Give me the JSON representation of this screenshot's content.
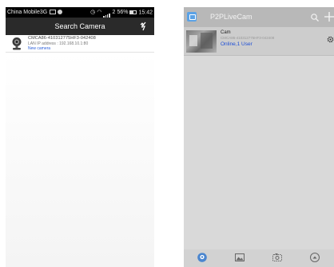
{
  "left_screen": {
    "status_bar": {
      "carrier": "China Mobile3G",
      "battery_percent": "56%",
      "time": "15:42",
      "network_label": "2"
    },
    "title_bar": {
      "title": "Search Camera",
      "refresh_icon": "refresh-icon"
    },
    "camera_item": {
      "name": "CMCA86-410312775HF3-042408",
      "lan_ip": "LAN IP address : 192.168.10.1:80",
      "status": "New camera",
      "icon": "webcam-icon"
    }
  },
  "right_screen": {
    "header": {
      "app_title": "P2PLiveCam",
      "search_icon": "search-icon",
      "add_icon": "plus-icon"
    },
    "camera_list": [
      {
        "name": "Cam",
        "id_text": "CMCA86-410312775HF3-042408",
        "status": "Online,1 User"
      }
    ],
    "tabs": [
      {
        "icon": "camera-tab-icon",
        "active": true
      },
      {
        "icon": "picture-tab-icon",
        "active": false
      },
      {
        "icon": "record-tab-icon",
        "active": false
      },
      {
        "icon": "more-tab-icon",
        "active": false
      }
    ],
    "accent_color": "#4b86cf"
  }
}
